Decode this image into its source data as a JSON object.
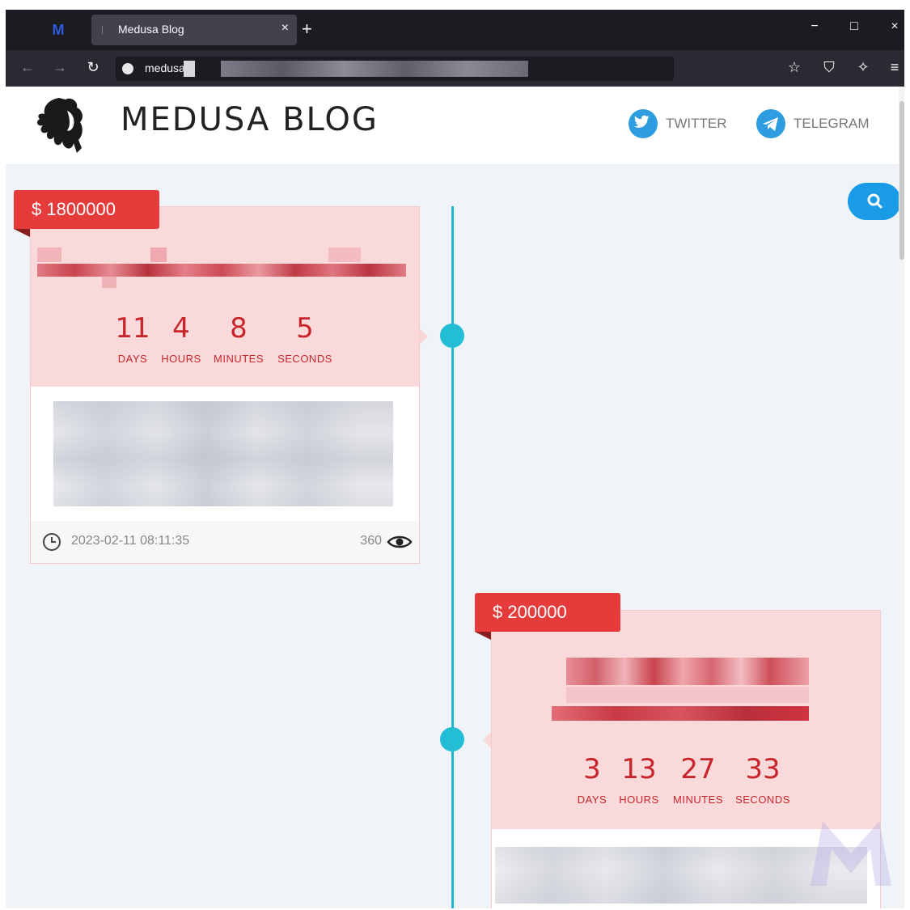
{
  "browser": {
    "tab_title": "Medusa Blog",
    "tab_close": "×",
    "new_tab": "+",
    "url": "medusa",
    "win_min": "−",
    "win_max": "□",
    "win_close": "×"
  },
  "site": {
    "title": "MEDUSA BLOG",
    "twitter": "TWITTER",
    "telegram": "TELEGRAM"
  },
  "posts": [
    {
      "price": "$ 1800000",
      "countdown": [
        {
          "value": "11",
          "unit": "DAYS"
        },
        {
          "value": "4",
          "unit": "HOURS"
        },
        {
          "value": "8",
          "unit": "MINUTES"
        },
        {
          "value": "5",
          "unit": "SECONDS"
        }
      ],
      "date": "2023-02-11 08:11:35",
      "views": "360"
    },
    {
      "price": "$ 200000",
      "countdown": [
        {
          "value": "3",
          "unit": "DAYS"
        },
        {
          "value": "13",
          "unit": "HOURS"
        },
        {
          "value": "27",
          "unit": "MINUTES"
        },
        {
          "value": "33",
          "unit": "SECONDS"
        }
      ]
    }
  ],
  "colors": {
    "accent": "#e53b3b",
    "timeline": "#1fb6cf",
    "card_bg": "#f9d9d9",
    "link_blue": "#2e9de0"
  }
}
